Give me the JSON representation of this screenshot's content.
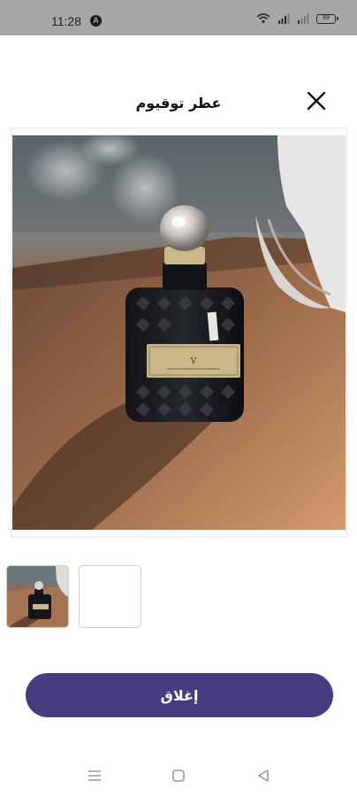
{
  "status_bar": {
    "time": "11:28",
    "indicator": "A",
    "battery": "69",
    "icons": [
      "wifi-icon",
      "signal-icon",
      "signal-icon",
      "battery-icon"
    ]
  },
  "dialog": {
    "title": "عطر توقيوم",
    "close_icon": "close-icon",
    "close_button_label": "إغلاق"
  },
  "gallery": {
    "main_image": "perfume-bottle-photo",
    "thumbnails": [
      {
        "image": "perfume-bottle-photo",
        "selected": true
      },
      {
        "image": "empty",
        "selected": false
      }
    ],
    "label_text": "Valentino"
  },
  "nav_bar": {
    "icons": [
      "menu-icon",
      "home-icon",
      "back-icon"
    ]
  },
  "colors": {
    "status_bar": "#a7a7a7",
    "button": "#463c80",
    "button_text": "#ffffff"
  }
}
